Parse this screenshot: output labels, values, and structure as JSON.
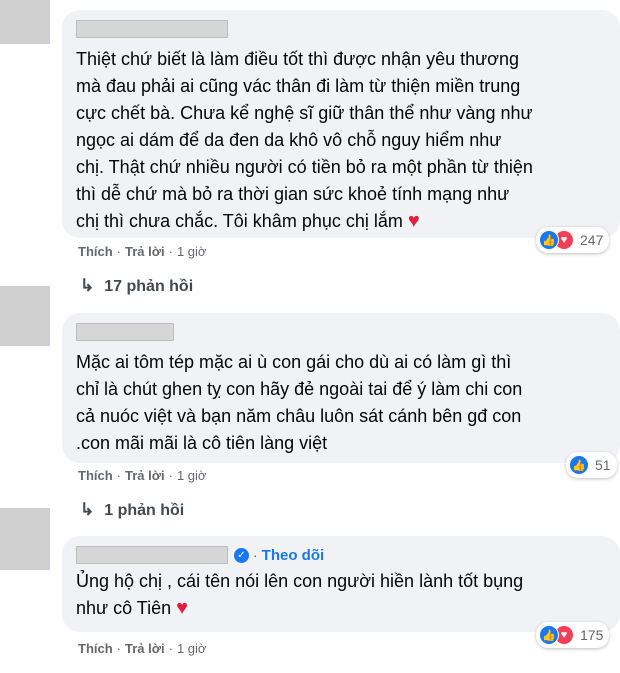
{
  "comments": [
    {
      "text": "Thiệt chứ biết là làm điều tốt thì được nhận yêu thương\nmà đau phải ai cũng vác thân đi làm từ thiện miền trung\ncực chết bà. Chưa kể nghệ sĩ giữ thân thể như vàng như\nngọc ai dám để da đen da khô vô chỗ nguy hiểm như\nchị. Thật chứ nhiều người có tiền bỏ ra một phần từ thiện\nthì dễ chứ mà bỏ ra thời gian sức khoẻ tính mạng như\nchị thì chưa chắc. Tôi khâm phục chị lắm",
      "heart": "♥",
      "like": "Thích",
      "reply": "Trả lời",
      "dot": "·",
      "time": "1 giờ",
      "reaction_count": "247",
      "replies": "17 phản hồi"
    },
    {
      "text": "Mặc ai tôm tép mặc ai ù con gái cho dù ai có làm gì thì\nchỉ là chút ghen tỵ con hãy đẻ ngoài tai để ý làm chi con\ncả nuóc việt và bạn năm châu luôn sát cánh bên gđ con\n.con mãi mãi là cô tiên làng việt",
      "like": "Thích",
      "reply": "Trả lời",
      "dot": "·",
      "time": "1 giờ",
      "reaction_count": "51",
      "replies": "1 phản hồi"
    },
    {
      "follow": "Theo dõi",
      "dot": "·",
      "text": "Ủng hộ chị , cái tên nói lên con người hiền lành tốt bụng\nnhư cô Tiên",
      "heart": "♥",
      "like": "Thích",
      "reply": "Trả lời",
      "time": "1 giờ",
      "reaction_count": "175"
    }
  ],
  "icons": {
    "like": "like-icon",
    "love": "love-icon",
    "reply_arrow": "reply-arrow-icon",
    "verified": "verified-badge-icon"
  },
  "colors": {
    "bubble": "#f0f2f5",
    "link": "#1877f2",
    "heart": "#e41e3f",
    "meta": "#65676b"
  }
}
